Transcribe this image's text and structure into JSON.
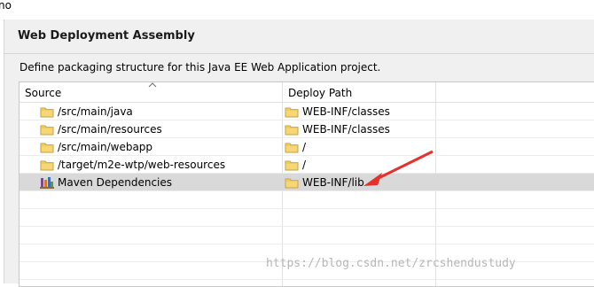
{
  "window": {
    "title_fragment": "no"
  },
  "panel": {
    "heading": "Web Deployment Assembly",
    "description": "Define packaging structure for this Java EE Web Application project."
  },
  "table": {
    "columns": {
      "source": "Source",
      "deploy_path": "Deploy Path"
    },
    "rows": [
      {
        "source": "/src/main/java",
        "source_icon": "folder-icon",
        "deploy": "WEB-INF/classes",
        "selected": false
      },
      {
        "source": "/src/main/resources",
        "source_icon": "folder-icon",
        "deploy": "WEB-INF/classes",
        "selected": false
      },
      {
        "source": "/src/main/webapp",
        "source_icon": "folder-icon",
        "deploy": "/",
        "selected": false
      },
      {
        "source": "/target/m2e-wtp/web-resources",
        "source_icon": "folder-icon",
        "deploy": "/",
        "selected": false
      },
      {
        "source": "Maven Dependencies",
        "source_icon": "library-icon",
        "deploy": "WEB-INF/lib",
        "selected": true
      }
    ]
  },
  "annotation": {
    "arrow_color": "#e8302a"
  },
  "watermark": "https://blog.csdn.net/zrcshendustudy"
}
